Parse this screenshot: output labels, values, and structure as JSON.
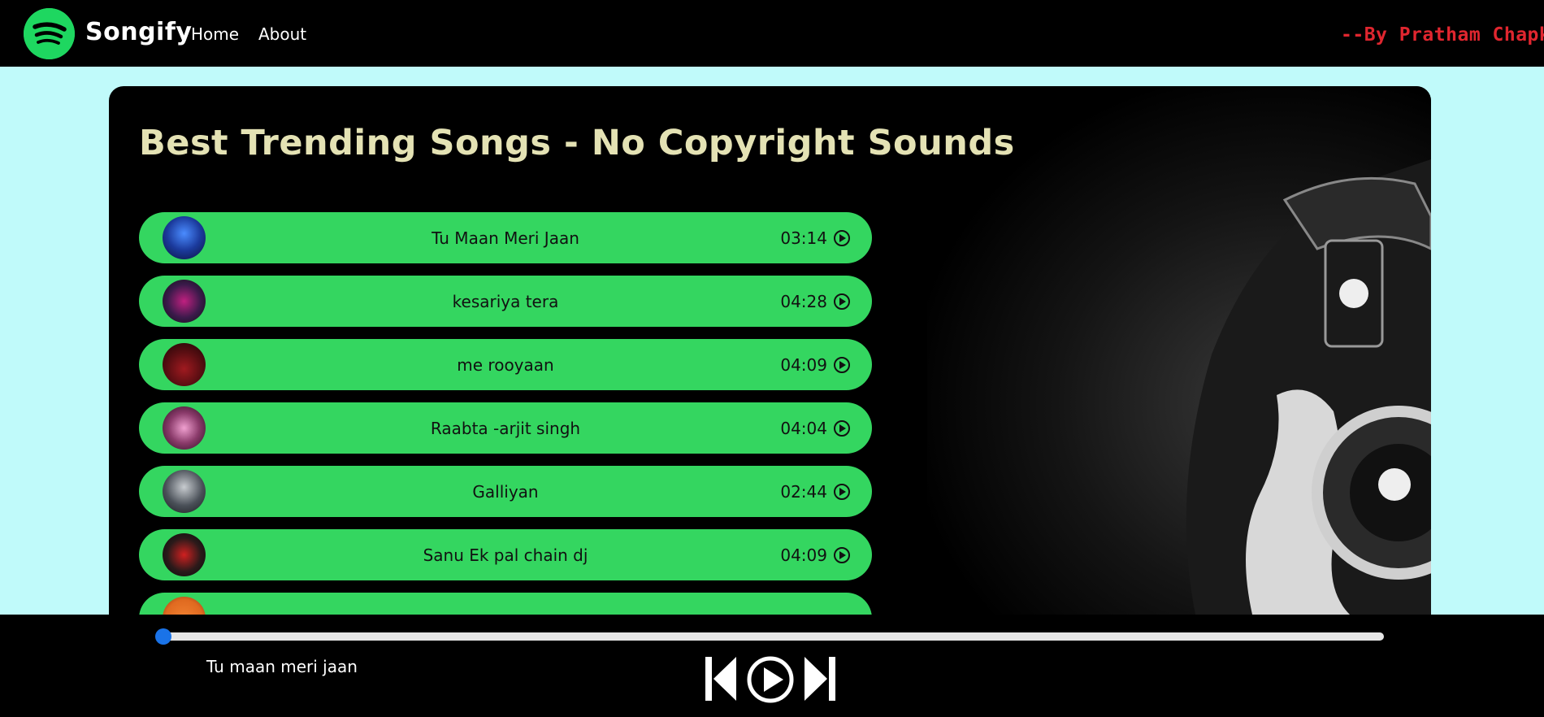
{
  "navbar": {
    "brand": "Songify",
    "links": [
      "Home",
      "About"
    ],
    "author": "--By Pratham Chapke"
  },
  "main": {
    "title": "Best Trending Songs - No Copyright Sounds",
    "songs": [
      {
        "name": "Tu Maan Meri Jaan",
        "duration": "03:14",
        "cover_color": "#1b3a9c"
      },
      {
        "name": "kesariya tera",
        "duration": "04:28",
        "cover_color": "#3a1a4a"
      },
      {
        "name": "me rooyaan",
        "duration": "04:09",
        "cover_color": "#5a0e12"
      },
      {
        "name": "Raabta -arjit singh",
        "duration": "04:04",
        "cover_color": "#8a3a6a"
      },
      {
        "name": "Galliyan",
        "duration": "02:44",
        "cover_color": "#4a5058"
      },
      {
        "name": "Sanu Ek pal chain dj",
        "duration": "04:09",
        "cover_color": "#2a1a1a"
      },
      {
        "name": "",
        "duration": "",
        "cover_color": "#e06a20"
      }
    ]
  },
  "player": {
    "now_playing": "Tu maan meri jaan",
    "progress": 0,
    "accent_color": "#1a73e8"
  },
  "colors": {
    "background": "#c0fafa",
    "song_item": "#34d660",
    "title": "#e4e2b4",
    "author": "#e0262f"
  }
}
